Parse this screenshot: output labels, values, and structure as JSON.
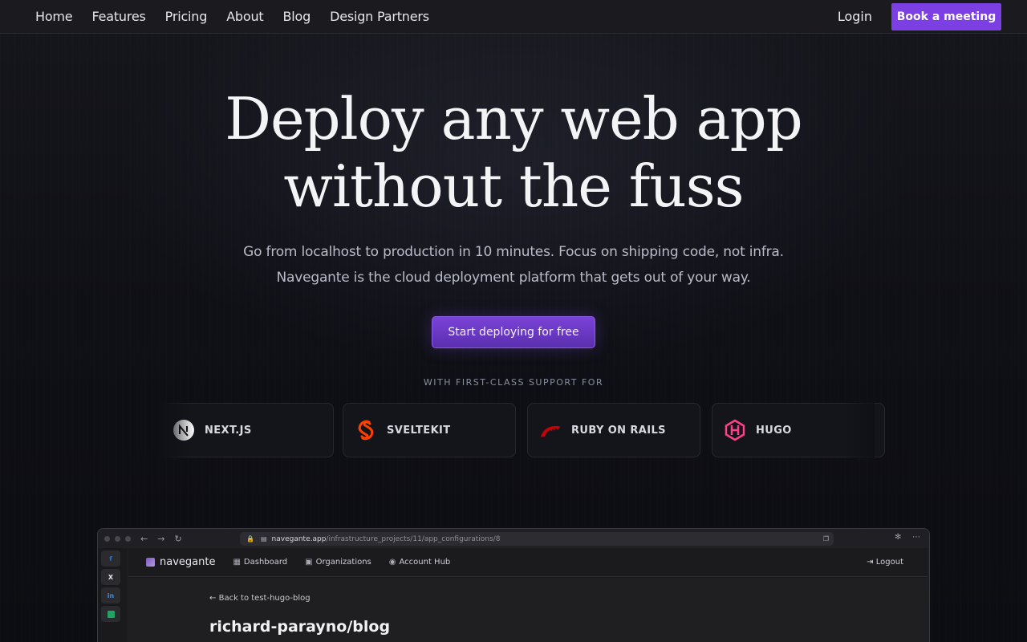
{
  "nav": {
    "links": [
      "Home",
      "Features",
      "Pricing",
      "About",
      "Blog",
      "Design Partners"
    ],
    "login": "Login",
    "book_meeting": "Book a meeting"
  },
  "hero": {
    "title_line1": "Deploy any web app",
    "title_line2": "without the fuss",
    "subtitle_line1": "Go from localhost to production in 10 minutes. Focus on shipping code, not infra.",
    "subtitle_line2": "Navegante is the cloud deployment platform that gets out of your way.",
    "cta": "Start deploying for free",
    "support_label": "WITH FIRST-CLASS SUPPORT FOR"
  },
  "frameworks": [
    {
      "name": "NEXT.JS",
      "icon": "nextjs-icon"
    },
    {
      "name": "SVELTEKIT",
      "icon": "svelte-icon"
    },
    {
      "name": "RUBY ON RAILS",
      "icon": "rails-icon"
    },
    {
      "name": "HUGO",
      "icon": "hugo-icon"
    }
  ],
  "browser": {
    "url_host": "navegante.app",
    "url_path": "/infrastructure_projects/11/app_configurations/8",
    "sidebar_icons": [
      "facebook-icon",
      "x-icon",
      "linkedin-icon",
      "sheets-icon"
    ],
    "app": {
      "logo": "navegante",
      "nav": [
        "Dashboard",
        "Organizations",
        "Account Hub"
      ],
      "logout": "Logout",
      "back_link": "Back to test-hugo-blog",
      "repo_title": "richard-parayno/blog"
    }
  },
  "colors": {
    "accent": "#7b3fe4",
    "background": "#0e0f14",
    "nav_bg": "#1b1b1f"
  }
}
